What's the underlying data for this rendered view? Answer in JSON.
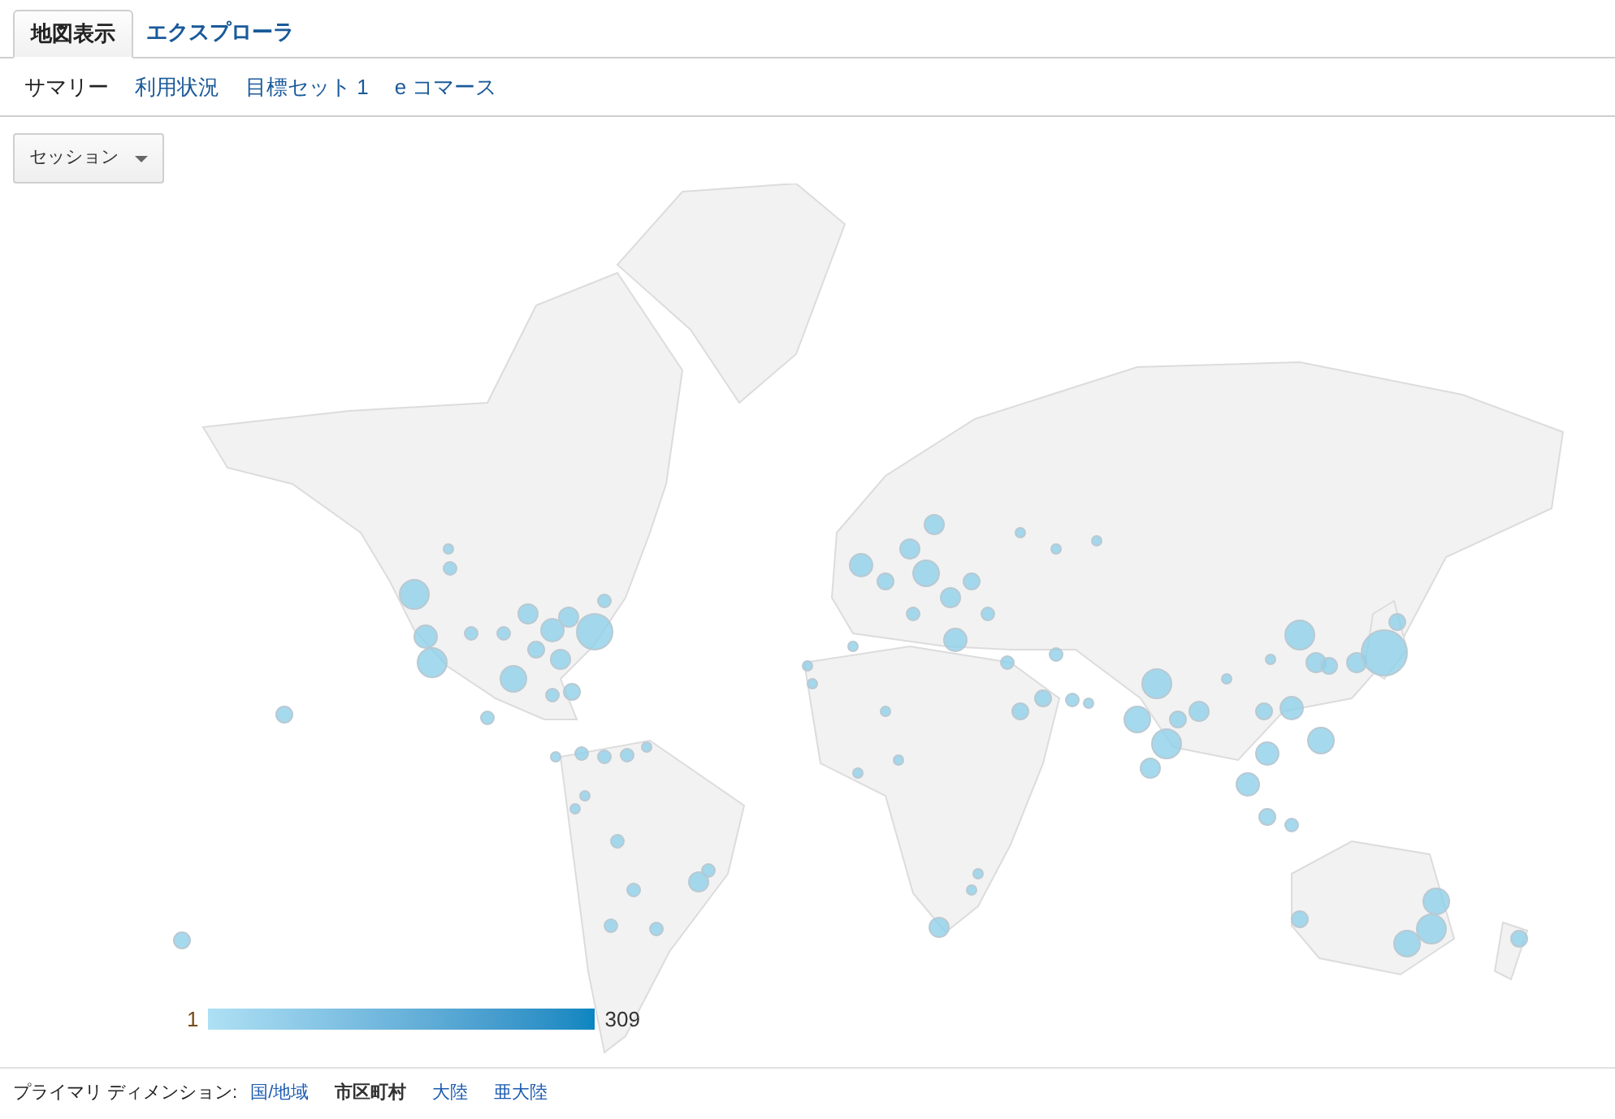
{
  "tabs": [
    {
      "label": "地図表示",
      "selected": true
    },
    {
      "label": "エクスプローラ",
      "selected": false
    }
  ],
  "subnav": [
    {
      "label": "サマリー",
      "selected": true
    },
    {
      "label": "利用状況",
      "selected": false
    },
    {
      "label": "目標セット 1",
      "selected": false
    },
    {
      "label": "e コマース",
      "selected": false
    }
  ],
  "metric_dropdown": {
    "value": "セッション"
  },
  "legend": {
    "min": "1",
    "max": "309"
  },
  "primary_dimension": {
    "label": "プライマリ ディメンション:",
    "options": [
      {
        "label": "国/地域",
        "selected": false
      },
      {
        "label": "市区町村",
        "selected": true
      },
      {
        "label": "大陸",
        "selected": false
      },
      {
        "label": "亜大陸",
        "selected": false
      }
    ]
  }
}
